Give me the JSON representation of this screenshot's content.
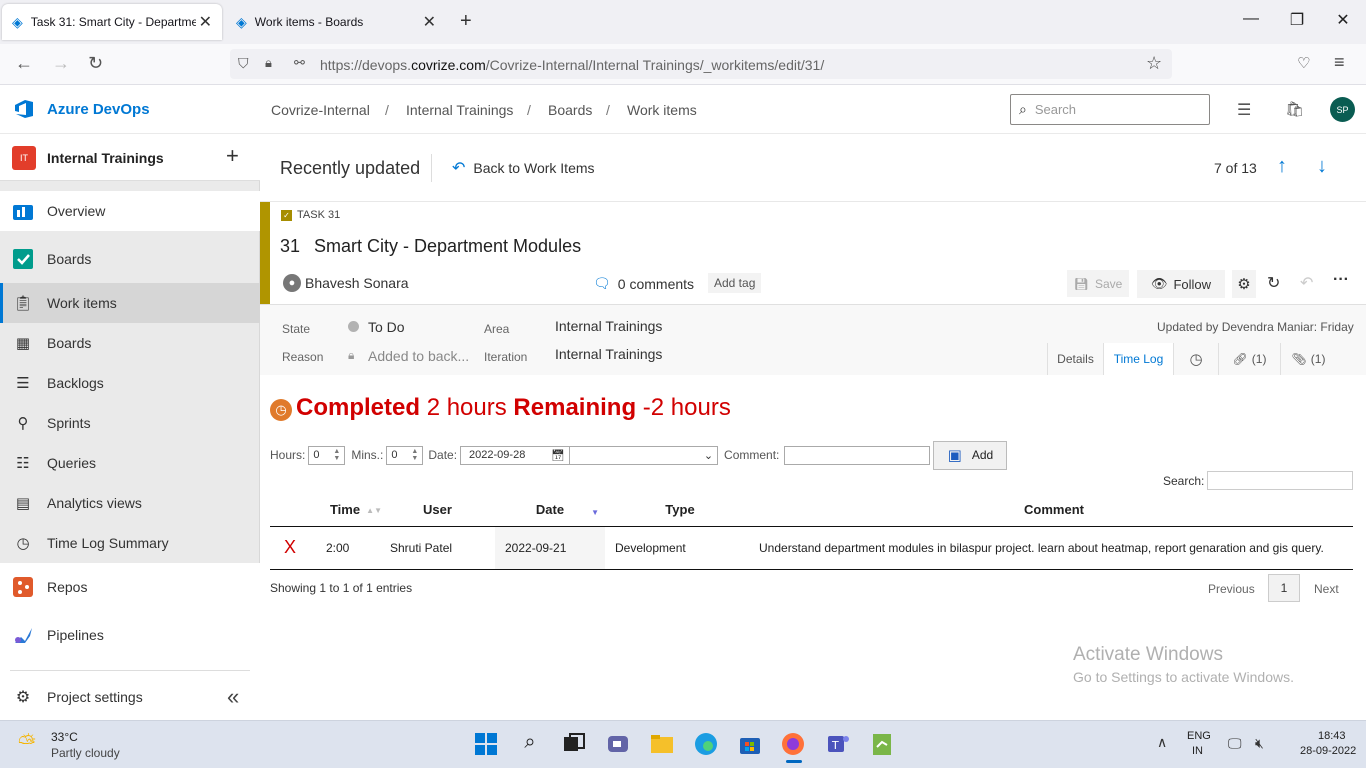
{
  "browser": {
    "tabs": [
      {
        "title": "Task 31: Smart City - Departmen",
        "active": true
      },
      {
        "title": "Work items - Boards",
        "active": false
      }
    ],
    "url_prefix": "https://devops.",
    "url_domain": "covrize.com",
    "url_path": "/Covrize-Internal/Internal Trainings/_workitems/edit/31/"
  },
  "header": {
    "product": "Azure DevOps",
    "breadcrumbs": [
      "Covrize-Internal",
      "Internal Trainings",
      "Boards",
      "Work items"
    ],
    "search_placeholder": "Search",
    "avatar": "SP",
    "accent": "#0078d4"
  },
  "sidebar": {
    "project_badge": "IT",
    "project_name": "Internal Trainings",
    "add_glyph": "+",
    "items": [
      {
        "label": "Overview",
        "icon": "overview-icon"
      },
      {
        "label": "Boards",
        "icon": "boards-icon"
      },
      {
        "label": "Work items",
        "icon": "work-items-icon"
      },
      {
        "label": "Boards",
        "icon": "board-icon"
      },
      {
        "label": "Backlogs",
        "icon": "backlogs-icon"
      },
      {
        "label": "Sprints",
        "icon": "sprints-icon"
      },
      {
        "label": "Queries",
        "icon": "queries-icon"
      },
      {
        "label": "Analytics views",
        "icon": "analytics-icon"
      },
      {
        "label": "Time Log Summary",
        "icon": "clock-icon"
      },
      {
        "label": "Repos",
        "icon": "repos-icon"
      },
      {
        "label": "Pipelines",
        "icon": "pipelines-icon"
      }
    ],
    "settings": "Project settings"
  },
  "workitem": {
    "list_title": "Recently updated",
    "back_label": "Back to Work Items",
    "position": "7 of 13",
    "type_label": "TASK 31",
    "id": "31",
    "title": "Smart City - Department Modules",
    "assignee": "Bhavesh Sonara",
    "comments": "0 comments",
    "add_tag": "Add tag",
    "save": "Save",
    "follow": "Follow",
    "state_label": "State",
    "state_value": "To Do",
    "reason_label": "Reason",
    "reason_value": "Added to back...",
    "area_label": "Area",
    "area_value": "Internal Trainings",
    "iteration_label": "Iteration",
    "iteration_value": "Internal Trainings",
    "updated": "Updated by Devendra Maniar: Friday",
    "tabs": {
      "details": "Details",
      "timelog": "Time Log",
      "links": "(1)",
      "attachments": "(1)"
    }
  },
  "timelog": {
    "completed_label": "Completed",
    "completed_value": "2 hours",
    "remaining_label": "Remaining",
    "remaining_value": "-2 hours",
    "hours_label": "Hours:",
    "hours_value": "0",
    "mins_label": "Mins.:",
    "mins_value": "0",
    "date_label": "Date:",
    "date_value": "2022-09-28",
    "comment_label": "Comment:",
    "add_label": "Add",
    "search_label": "Search:",
    "columns": [
      "Time",
      "User",
      "Date",
      "Type",
      "Comment"
    ],
    "rows": [
      {
        "delete": "X",
        "time": "2:00",
        "user": "Shruti Patel",
        "date": "2022-09-21",
        "type": "Development",
        "comment": "Understand department modules in bilaspur project. learn about heatmap, report genaration and gis query."
      }
    ],
    "showing": "Showing 1 to 1 of 1 entries",
    "prev": "Previous",
    "page": "1",
    "next": "Next"
  },
  "watermark": {
    "line1": "Activate Windows",
    "line2": "Go to Settings to activate Windows."
  },
  "taskbar": {
    "temp": "33°C",
    "weather": "Partly cloudy",
    "lang1": "ENG",
    "lang2": "IN",
    "time": "18:43",
    "date": "28-09-2022"
  }
}
